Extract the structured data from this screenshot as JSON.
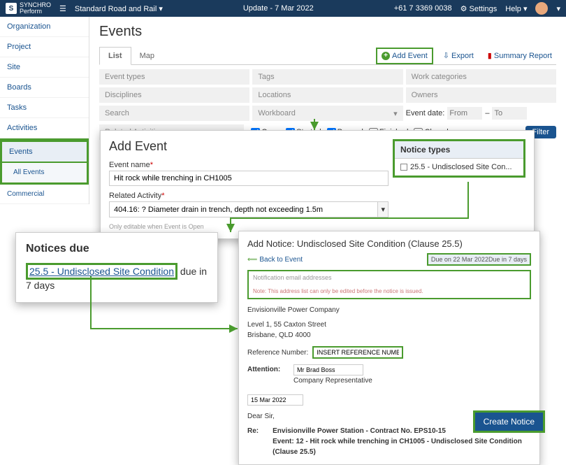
{
  "topbar": {
    "brand_top": "SYNCHRO",
    "brand_sub": "Perform",
    "project_dropdown": "Standard Road and Rail",
    "update_text": "Update - 7 Mar 2022",
    "phone": "+61 7 3369 0038",
    "settings": "Settings",
    "help": "Help"
  },
  "sidebar": {
    "items": [
      "Organization",
      "Project",
      "Site",
      "Boards",
      "Tasks",
      "Activities",
      "Events"
    ],
    "sub": "All Events",
    "commercial": "Commercial"
  },
  "events": {
    "title": "Events",
    "tabs": {
      "list": "List",
      "map": "Map"
    },
    "actions": {
      "add": "Add Event",
      "export": "Export",
      "summary": "Summary Report"
    },
    "filters": {
      "event_types": "Event types",
      "tags": "Tags",
      "work_cats": "Work categories",
      "disciplines": "Disciplines",
      "locations": "Locations",
      "owners": "Owners",
      "search": "Search",
      "workboard": "Workboard",
      "event_date": "Event date:",
      "from": "From",
      "to": "To",
      "related": "Related Activities"
    },
    "status": {
      "open": "Open",
      "started": "Started",
      "paused": "Paused",
      "finished": "Finished",
      "closed": "Closed"
    },
    "filter_btn": "Filter"
  },
  "add_event": {
    "title": "Add Event",
    "name_label": "Event name",
    "name_value": "Hit rock while trenching in CH1005",
    "related_label": "Related Activity",
    "related_value": "404.16: ? Diameter drain in trench, depth not exceeding 1.5m",
    "note": "Only editable when Event is Open",
    "notice_types_label": "Notice types",
    "notice_types_value": "25.5 - Undisclosed Site Con..."
  },
  "notices_due": {
    "title": "Notices due",
    "link": "25.5 - Undisclosed Site Condition",
    "suffix": " due in 7 days"
  },
  "add_notice": {
    "title": "Add Notice: Undisclosed Site Condition (Clause 25.5)",
    "back": "Back to Event",
    "due": "Due on 22 Mar 2022",
    "due_in": "Due in 7 days",
    "email_label": "Notification email addresses",
    "email_note": "Note: This address list can only be edited before the notice is issued.",
    "addr1": "Envisionville Power Company",
    "addr2": "Level 1, 55 Caxton Street",
    "addr3": "Brisbane, QLD 4000",
    "ref_label": "Reference Number:",
    "ref_value": "INSERT REFERENCE NUMBER",
    "attn_label": "Attention:",
    "attn_value": "Mr Brad Boss",
    "attn_role": "Company Representative",
    "date": "15 Mar 2022",
    "salutation": "Dear Sir,",
    "re_label": "Re:",
    "re_line1": "Envisionville Power Station - Contract No. EPS10-15",
    "re_line2": "Event: 12 - Hit rock while trenching in CH1005 - Undisclosed Site Condition (Clause 25.5)",
    "create_btn": "Create Notice"
  }
}
